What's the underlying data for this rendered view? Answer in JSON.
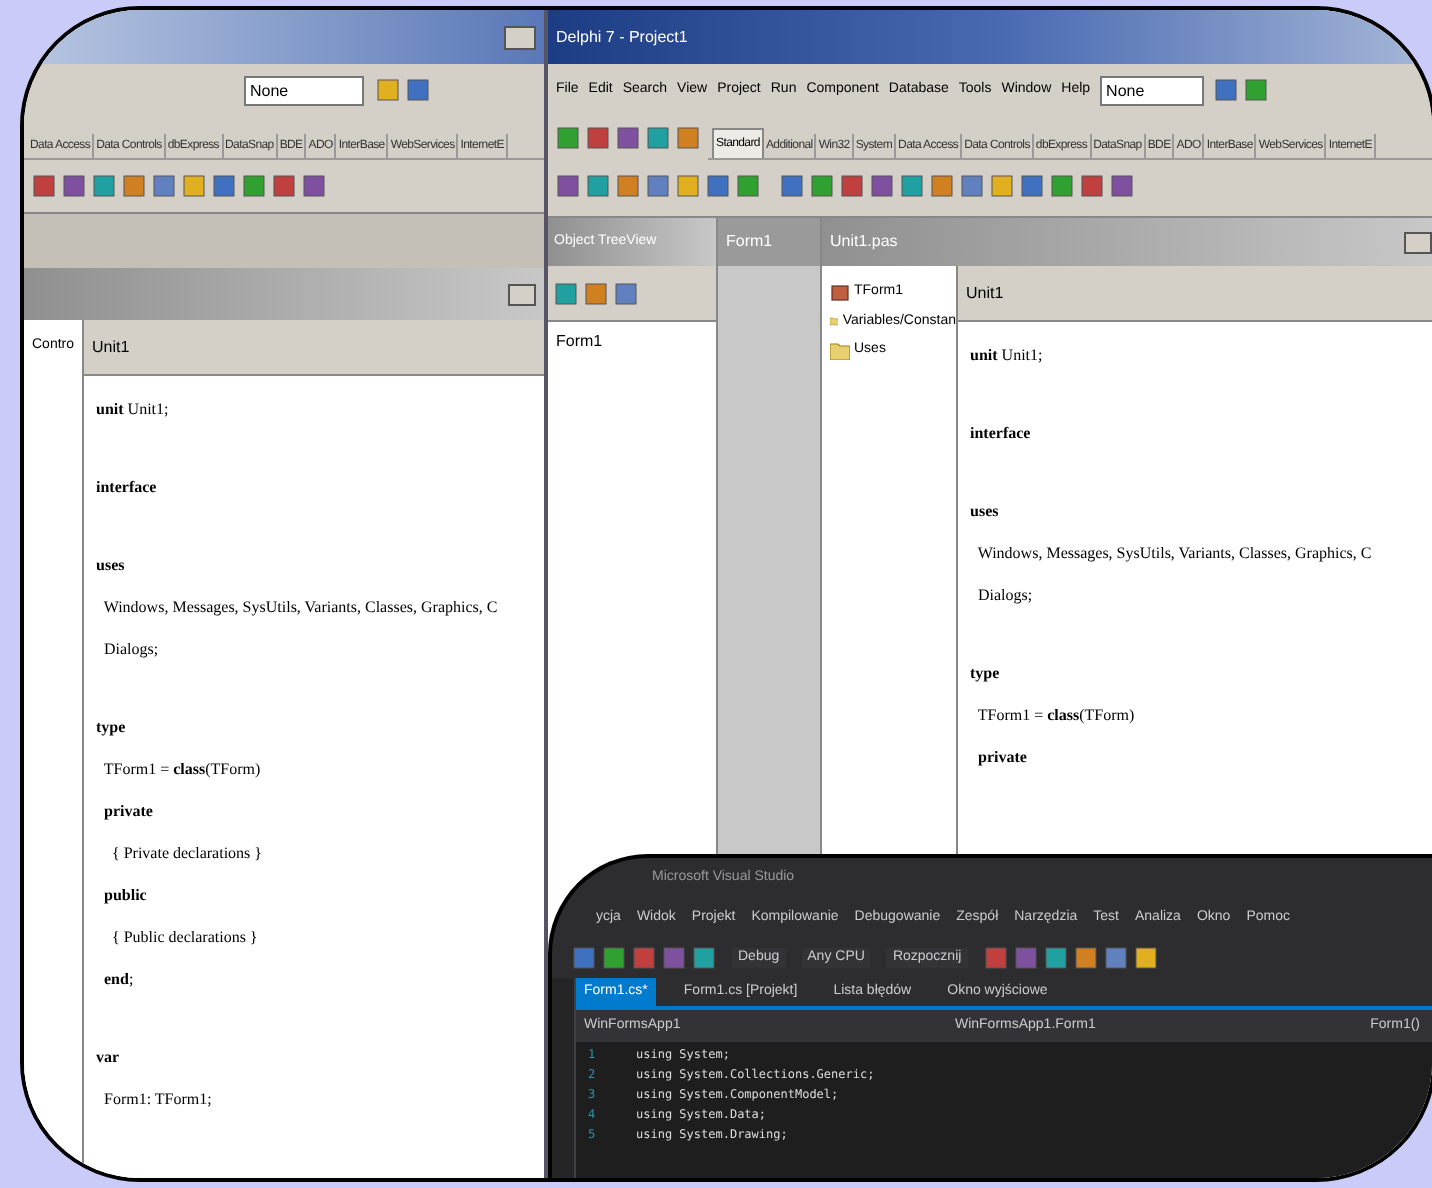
{
  "left_window": {
    "combo": "None",
    "palette_tabs": [
      {
        "label": "Data Access",
        "selected": false
      },
      {
        "label": "Data Controls",
        "selected": false
      },
      {
        "label": "dbExpress",
        "selected": false
      },
      {
        "label": "DataSnap",
        "selected": false
      },
      {
        "label": "BDE",
        "selected": false
      },
      {
        "label": "ADO",
        "selected": false
      },
      {
        "label": "InterBase",
        "selected": false
      },
      {
        "label": "WebServices",
        "selected": false
      },
      {
        "label": "InternetE",
        "selected": false
      }
    ],
    "explorer_items": [
      {
        "label": "Contro"
      }
    ],
    "editor_tab": "Unit1",
    "code": [
      {
        "text": "**unit** Unit1;",
        "spaced": false
      },
      {
        "text": "**interface**",
        "spaced": true
      },
      {
        "text": "**uses**",
        "spaced": true
      },
      {
        "text": "  Windows, Messages, SysUtils, Variants, Classes, Graphics, C",
        "spaced": false
      },
      {
        "text": "  Dialogs;",
        "spaced": false
      },
      {
        "text": "**type**",
        "spaced": true
      },
      {
        "text": "  TForm1 = **class**(TForm)",
        "spaced": false
      },
      {
        "text": "  **private**",
        "spaced": false
      },
      {
        "text": "    { Private declarations }",
        "spaced": false
      },
      {
        "text": "  **public**",
        "spaced": false
      },
      {
        "text": "    { Public declarations }",
        "spaced": false
      },
      {
        "text": "  **end**;",
        "spaced": false
      },
      {
        "text": "**var**",
        "spaced": true
      },
      {
        "text": "  Form1: TForm1;",
        "spaced": false
      }
    ]
  },
  "right_window": {
    "title": "Delphi 7 - Project1",
    "menu": [
      "File",
      "Edit",
      "Search",
      "View",
      "Project",
      "Run",
      "Component",
      "Database",
      "Tools",
      "Window",
      "Help"
    ],
    "combo": "None",
    "palette_tabs": [
      {
        "label": "Standard",
        "selected": true
      },
      {
        "label": "Additional",
        "selected": false
      },
      {
        "label": "Win32",
        "selected": false
      },
      {
        "label": "System",
        "selected": false
      },
      {
        "label": "Data Access",
        "selected": false
      },
      {
        "label": "Data Controls",
        "selected": false
      },
      {
        "label": "dbExpress",
        "selected": false
      },
      {
        "label": "DataSnap",
        "selected": false
      },
      {
        "label": "BDE",
        "selected": false
      },
      {
        "label": "ADO",
        "selected": false
      },
      {
        "label": "InterBase",
        "selected": false
      },
      {
        "label": "WebServices",
        "selected": false
      },
      {
        "label": "InternetE",
        "selected": false
      }
    ],
    "tree_view": {
      "title": "Object TreeView",
      "items": [
        "Form1"
      ]
    },
    "inspector": {
      "title": "Form1"
    },
    "editor_title": "Unit1.pas",
    "explorer_items": [
      {
        "label": "TForm1",
        "kind": "class"
      },
      {
        "label": "Variables/Constan",
        "kind": "folder"
      },
      {
        "label": "Uses",
        "kind": "folder"
      }
    ],
    "editor_tab": "Unit1",
    "code": [
      {
        "text": "**unit** Unit1;",
        "spaced": false
      },
      {
        "text": "**interface**",
        "spaced": true
      },
      {
        "text": "**uses**",
        "spaced": true
      },
      {
        "text": "  Windows, Messages, SysUtils, Variants, Classes, Graphics, C",
        "spaced": false
      },
      {
        "text": "  Dialogs;",
        "spaced": false
      },
      {
        "text": "**type**",
        "spaced": true
      },
      {
        "text": "  TForm1 = **class**(TForm)",
        "spaced": false
      },
      {
        "text": "  **private**",
        "spaced": false
      }
    ]
  },
  "vs_window": {
    "title": "Microsoft Visual Studio",
    "menu": [
      "ycja",
      "Widok",
      "Projekt",
      "Kompilowanie",
      "Debugowanie",
      "Zespół",
      "Narzędzia",
      "Test",
      "Analiza",
      "Okno",
      "Pomoc"
    ],
    "configuration": "Debug",
    "platform": "Any CPU",
    "start": "Rozpocznij",
    "tabs": [
      {
        "label": "Form1.cs*",
        "selected": true
      },
      {
        "label": "Form1.cs [Projekt]",
        "selected": false
      },
      {
        "label": "Lista błędów",
        "selected": false
      },
      {
        "label": "Okno wyjściowe",
        "selected": false
      }
    ],
    "nav_left": "WinFormsApp1",
    "nav_middle": "WinFormsApp1.Form1",
    "nav_right": "Form1()",
    "lines": [
      {
        "number": "1",
        "text": "using System;"
      },
      {
        "number": "2",
        "text": "using System.Collections.Generic;"
      },
      {
        "number": "3",
        "text": "using System.ComponentModel;"
      },
      {
        "number": "4",
        "text": "using System.Data;"
      },
      {
        "number": "5",
        "text": "using System.Drawing;"
      }
    ]
  }
}
